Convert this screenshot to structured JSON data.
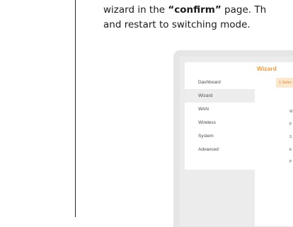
{
  "instructions": {
    "line1_prefix": "wizard in the ",
    "line1_quote_open": "“",
    "line1_bold": "confirm",
    "line1_quote_close": "”",
    "line1_suffix": " page. Th",
    "line2": "and restart to switching mode."
  },
  "sidebar": {
    "items": [
      {
        "label": "Dashboard"
      },
      {
        "label": "Wizard"
      },
      {
        "label": "WAN"
      },
      {
        "label": "Wireless"
      },
      {
        "label": "System"
      },
      {
        "label": "Advanced"
      }
    ]
  },
  "wizard": {
    "title": "Wizard",
    "step_tab": "1.Selec",
    "field_labels": [
      "W",
      "P",
      "S",
      "E",
      "P"
    ]
  },
  "colors": {
    "accent": "#f29a3f",
    "tab_background": "#fce7cf",
    "active_item_background": "#ededed"
  }
}
